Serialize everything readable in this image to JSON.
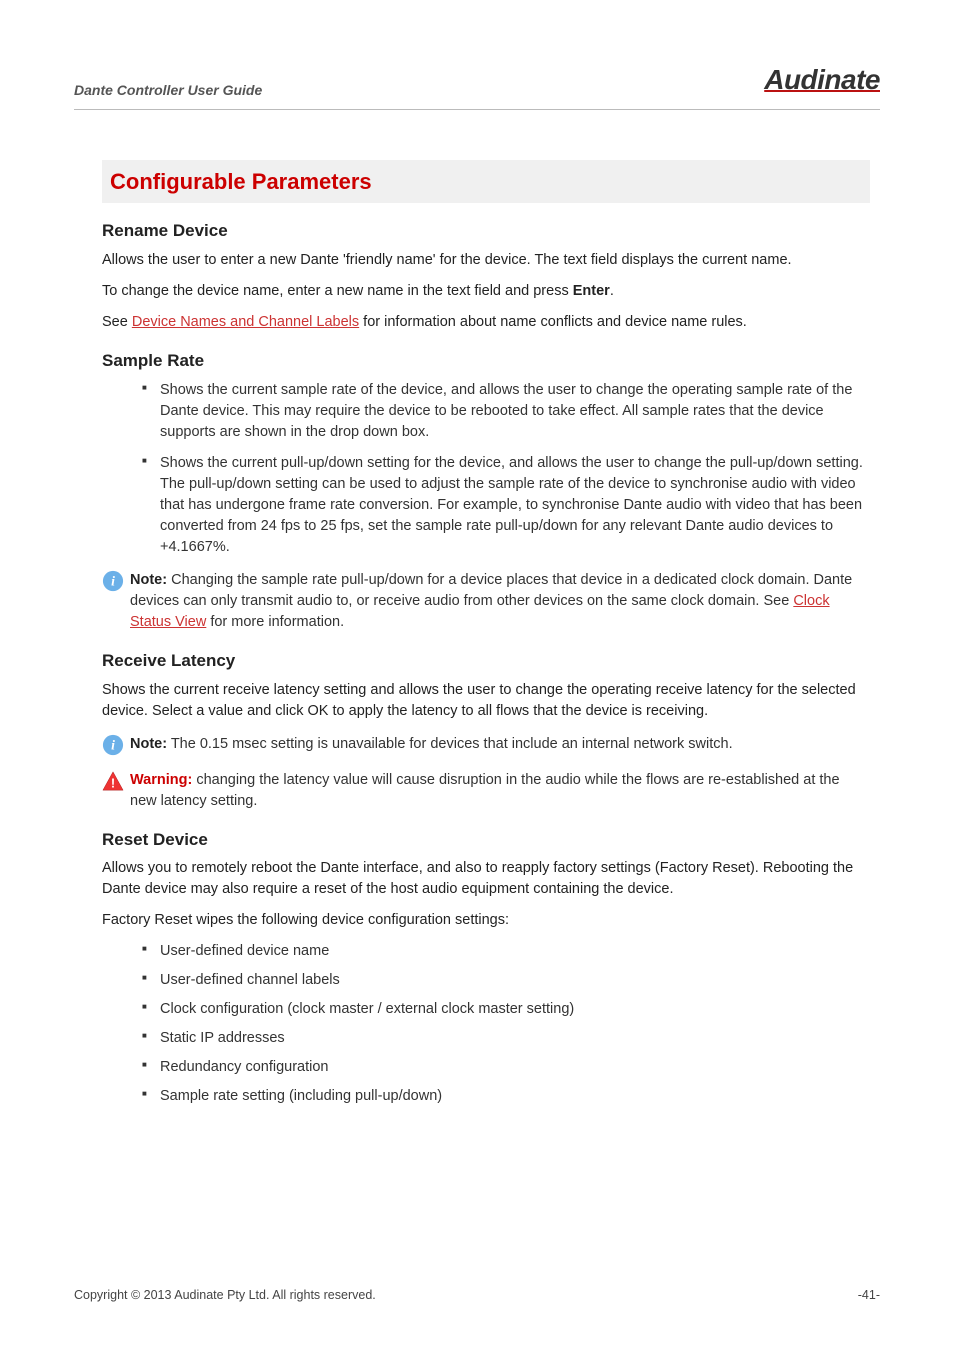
{
  "header": {
    "title": "Dante Controller User Guide",
    "logo": "Audinate"
  },
  "section": {
    "title": "Configurable Parameters"
  },
  "rename": {
    "heading": "Rename Device",
    "p1": "Allows the user to enter a new Dante 'friendly name' for the device. The text field displays the current name.",
    "p2a": "To change the device name, enter a new name in the text field and press ",
    "p2_bold": "Enter",
    "p2b": ".",
    "p3a": "See ",
    "p3_link": "Device Names and Channel Labels",
    "p3b": " for information about name conflicts and device name rules."
  },
  "sample_rate": {
    "heading": "Sample Rate",
    "b1": "Shows the current sample rate of the device, and allows the user to change the operating sample rate of the Dante device. This may require the device to be rebooted to take effect. All sample rates that the device supports are shown in the drop down box.",
    "b2": "Shows the current pull-up/down setting for the device, and allows the user to change the pull-up/down setting. The pull-up/down setting can be used to adjust the sample rate of the device to synchronise audio with video that has undergone frame rate conversion. For example, to synchronise Dante audio with video that has been converted from 24 fps to 25 fps, set the sample rate pull-up/down for any relevant Dante audio devices to +4.1667%.",
    "note_label": "Note:",
    "note_a": "  Changing the sample rate pull-up/down for a device places that device in a dedicated clock domain. Dante devices can only transmit audio to, or receive audio from other devices on the same clock domain. See ",
    "note_link": "Clock Status View",
    "note_b": " for more information."
  },
  "latency": {
    "heading": "Receive Latency",
    "p1": "Shows the current receive latency setting and allows the user to change the operating receive latency for the selected device. Select a value and click OK to apply the latency to all flows that the device is receiving.",
    "note_label": "Note:",
    "note_text": "  The 0.15 msec setting is unavailable for devices that include an internal network switch.",
    "warn_label": "Warning:",
    "warn_text": "  changing the latency value will cause disruption in the audio while the flows are re-established at the new latency setting."
  },
  "reset": {
    "heading": "Reset Device",
    "p1": "Allows you to remotely reboot the Dante interface, and also to reapply factory settings (Factory Reset). Rebooting the Dante device may also require a reset of the host audio equipment containing the device.",
    "p2": "Factory Reset wipes the following device configuration settings:",
    "items": {
      "0": "User-defined device name",
      "1": "User-defined channel labels",
      "2": "Clock configuration (clock master / external clock master setting)",
      "3": "Static IP addresses",
      "4": "Redundancy configuration",
      "5": "Sample rate setting (including pull-up/down)"
    }
  },
  "footer": {
    "copyright": "Copyright © 2013 Audinate Pty Ltd. All rights reserved.",
    "page": "-41-"
  }
}
